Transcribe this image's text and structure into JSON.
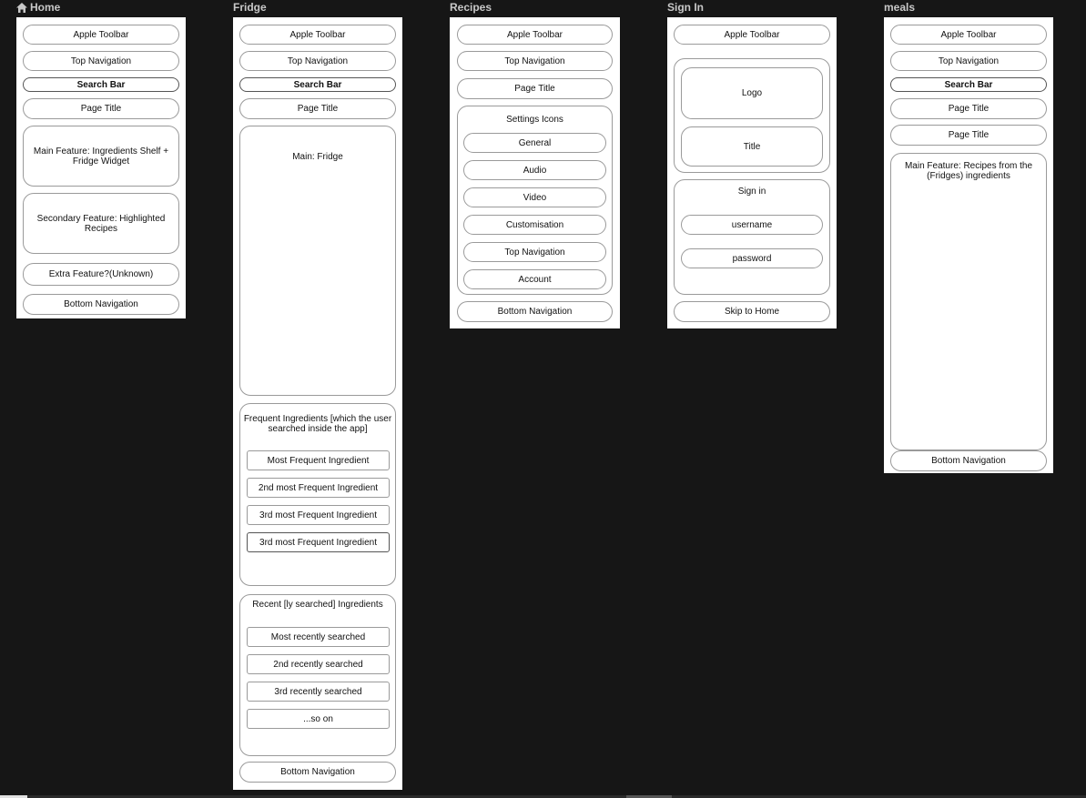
{
  "labels": {
    "home": "Home",
    "fridge": "Fridge",
    "recipes": "Recipes",
    "signin": "Sign In",
    "meals": "meals"
  },
  "home": {
    "apple_toolbar": "Apple Toolbar",
    "top_navigation": "Top Navigation",
    "search_bar": "Search Bar",
    "page_title": "Page Title",
    "main_feature": "Main Feature: Ingredients Shelf + Fridge Widget",
    "secondary_feature": "Secondary Feature: Highlighted Recipes",
    "extra_feature": "Extra Feature?(Unknown)",
    "bottom_navigation": "Bottom Navigation"
  },
  "fridge": {
    "apple_toolbar": "Apple Toolbar",
    "top_navigation": "Top Navigation",
    "search_bar": "Search Bar",
    "page_title": "Page Title",
    "main": "Main: Fridge",
    "frequent_title": "Frequent Ingredients [which the user searched inside the app]",
    "frequent_items": [
      "Most Frequent Ingredient",
      "2nd most Frequent Ingredient",
      "3rd most Frequent Ingredient",
      "3rd most Frequent Ingredient"
    ],
    "recent_title": "Recent [ly searched] Ingredients",
    "recent_items": [
      "Most recently searched",
      "2nd recently searched",
      "3rd recently searched",
      "...so on"
    ],
    "bottom_navigation": "Bottom Navigation"
  },
  "recipes": {
    "apple_toolbar": "Apple Toolbar",
    "top_navigation": "Top Navigation",
    "page_title": "Page Title",
    "settings_title": "Settings Icons",
    "settings_items": [
      "General",
      "Audio",
      "Video",
      "Customisation",
      "Top Navigation",
      "Account"
    ],
    "bottom_navigation": "Bottom Navigation"
  },
  "signin": {
    "apple_toolbar": "Apple Toolbar",
    "logo": "Logo",
    "title": "Title",
    "signin_title": "Sign in",
    "username": "username",
    "password": "password",
    "skip": "Skip to Home"
  },
  "meals": {
    "apple_toolbar": "Apple Toolbar",
    "top_navigation": "Top Navigation",
    "search_bar": "Search Bar",
    "page_title_1": "Page Title",
    "page_title_2": "Page Title",
    "main_feature": "Main Feature: Recipes from the (Fridges) ingredients",
    "bottom_navigation": "Bottom Navigation"
  }
}
